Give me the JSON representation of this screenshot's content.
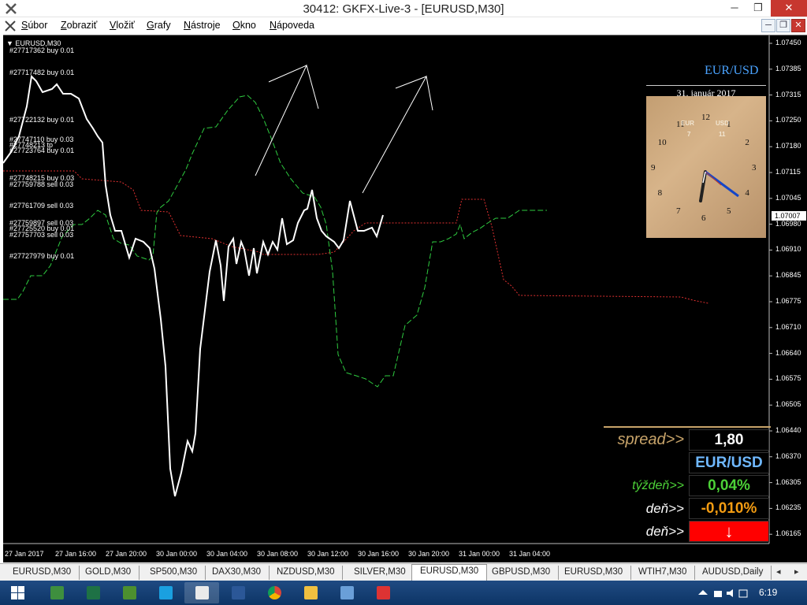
{
  "window": {
    "title": "30412: GKFX-Live-3 - [EURUSD,M30]",
    "min": "─",
    "max": "❐",
    "close": "✕"
  },
  "menu": [
    {
      "label": "Súbor",
      "underline": "S",
      "rest": "úbor"
    },
    {
      "label": "Zobraziť",
      "underline": "Z",
      "rest": "obraziť"
    },
    {
      "label": "Vložiť",
      "underline": "V",
      "rest": "ložiť"
    },
    {
      "label": "Grafy",
      "underline": "G",
      "rest": "rafy"
    },
    {
      "label": "Nástroje",
      "underline": "N",
      "rest": "ástroje"
    },
    {
      "label": "Okno",
      "underline": "O",
      "rest": "kno"
    },
    {
      "label": "Nápoveda",
      "underline": "N",
      "rest": "ápoveda"
    }
  ],
  "chart": {
    "symbol": "EURUSD,M30",
    "current_price": "1.07007",
    "price_ticks": [
      "1.07450",
      "1.07385",
      "1.07315",
      "1.07250",
      "1.07180",
      "1.07115",
      "1.07045",
      "1.06980",
      "1.06910",
      "1.06845",
      "1.06775",
      "1.06710",
      "1.06640",
      "1.06575",
      "1.06505",
      "1.06440",
      "1.06370",
      "1.06305",
      "1.06235",
      "1.06165"
    ],
    "time_ticks": [
      "27 Jan 2017",
      "27 Jan 16:00",
      "27 Jan 20:00",
      "30 Jan 00:00",
      "30 Jan 04:00",
      "30 Jan 08:00",
      "30 Jan 12:00",
      "30 Jan 16:00",
      "30 Jan 20:00",
      "31 Jan 00:00",
      "31 Jan 04:00"
    ],
    "orders": [
      {
        "text": "#27717362 buy 0.01"
      },
      {
        "text": "#27717482 buy 0.01"
      },
      {
        "text": "#27722132 buy 0.01"
      },
      {
        "text": "#27747110 buy 0.03"
      },
      {
        "text": "#27748213 tp"
      },
      {
        "text": "#27723764 buy 0.01"
      },
      {
        "text": "#27748215 buy 0.03"
      },
      {
        "text": "#27759788 sell 0.03"
      },
      {
        "text": "#27761709 sell 0.03"
      },
      {
        "text": "#27759897 sell 0.03"
      },
      {
        "text": "#27725520 buy 0.01"
      },
      {
        "text": "#27757703 sell 0.03"
      },
      {
        "text": "#27727979 buy 0.01"
      }
    ],
    "colors": {
      "price_line": "#ffffff",
      "green_line": "#2ecc40",
      "red_line": "#e03030",
      "background": "#000000"
    }
  },
  "pair_title": "EUR/USD",
  "clock": {
    "date": "31. január 2017",
    "numbers": [
      "12",
      "1",
      "2",
      "3",
      "4",
      "5",
      "6",
      "7",
      "8",
      "9",
      "10",
      "11"
    ],
    "zone1_label": "EUR",
    "zone1_value": "7",
    "zone2_label": "USD",
    "zone2_value": "11"
  },
  "info": {
    "spread_label": "spread>>",
    "spread_value": "1,80",
    "pair_label": "EUR/USD",
    "week_label": "týždeň>>",
    "week_value": "0,04%",
    "day_label": "deň>>",
    "day_value": "-0,010%",
    "day2_label": "deň>>",
    "day2_value": "↓",
    "colors": {
      "spread": "#c8a46a",
      "week": "#4cd137",
      "day": "#f39c12",
      "down": "#ff0000",
      "pair": "#6fb8ff"
    }
  },
  "tabs": [
    {
      "label": "EURUSD,M30",
      "active": false
    },
    {
      "label": "GOLD,M30",
      "active": false
    },
    {
      "label": "SP500,M30",
      "active": false
    },
    {
      "label": "DAX30,M30",
      "active": false
    },
    {
      "label": "NZDUSD,M30",
      "active": false
    },
    {
      "label": "SILVER,M30",
      "active": false
    },
    {
      "label": "EURUSD,M30",
      "active": true
    },
    {
      "label": "GBPUSD,M30",
      "active": false
    },
    {
      "label": "EURUSD,M30",
      "active": false
    },
    {
      "label": "WTIH7,M30",
      "active": false
    },
    {
      "label": "AUDUSD,Daily",
      "active": false
    }
  ],
  "taskbar": {
    "apps": [
      {
        "icon": "windows-start-icon"
      },
      {
        "icon": "explorer-app-icon"
      },
      {
        "icon": "excel-icon"
      },
      {
        "icon": "globe-app-icon"
      },
      {
        "icon": "skype-icon"
      },
      {
        "icon": "metatrader-icon"
      },
      {
        "icon": "word-icon"
      },
      {
        "icon": "chrome-icon"
      },
      {
        "icon": "file-explorer-icon"
      },
      {
        "icon": "app-icon"
      },
      {
        "icon": "app-dots-icon"
      }
    ],
    "time": "6:19"
  }
}
